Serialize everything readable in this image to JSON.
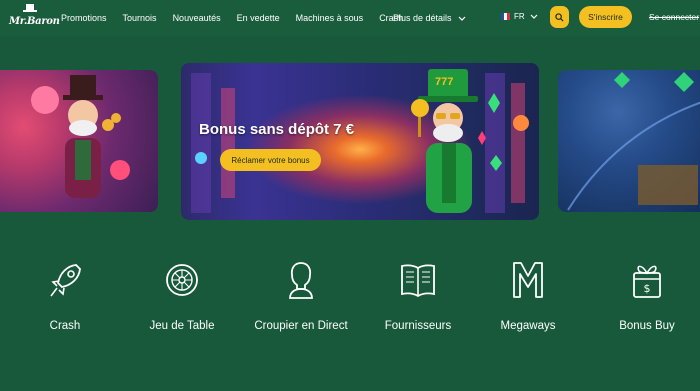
{
  "brand": {
    "logo_text": "Mr.Baron"
  },
  "nav": {
    "items": [
      "Promotions",
      "Tournois",
      "Nouveautés",
      "En vedette",
      "Machines à sous",
      "Crash"
    ],
    "more_label": "Plus de détails"
  },
  "header": {
    "language": "FR",
    "search_icon": "search-icon",
    "signup_label": "S'inscrire",
    "login_label": "Se connecter"
  },
  "banner": {
    "title": "Bonus sans dépôt 7 €",
    "cta_label": "Réclamer votre bonus",
    "hat_number": "777"
  },
  "categories": [
    {
      "label": "Crash",
      "icon": "rocket-icon"
    },
    {
      "label": "Jeu de Table",
      "icon": "roulette-icon"
    },
    {
      "label": "Croupier en Direct",
      "icon": "dealer-icon"
    },
    {
      "label": "Fournisseurs",
      "icon": "book-icon"
    },
    {
      "label": "Megaways",
      "icon": "megaways-icon"
    },
    {
      "label": "Bonus Buy",
      "icon": "gift-icon"
    }
  ],
  "colors": {
    "background": "#17593a",
    "accent": "#f4c021",
    "text": "#ffffff"
  }
}
